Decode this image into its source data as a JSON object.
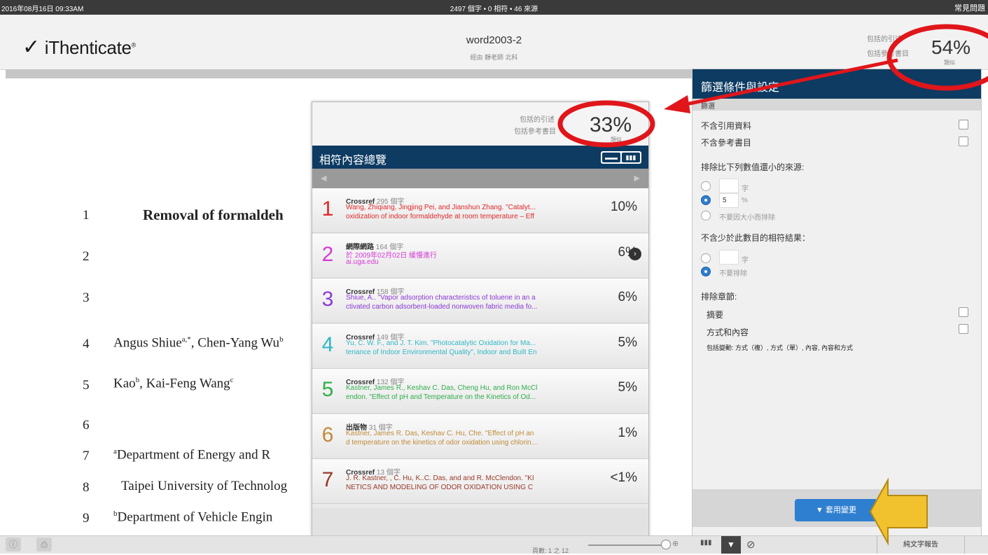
{
  "topbar": {
    "datetime": "2016年08月16日 09:33AM",
    "stats": "2497 個字 • 0 相符 • 46 來源",
    "help": "常見問題"
  },
  "header": {
    "logo_text": "iThenticate",
    "logo_mark": "®",
    "doc_title": "word2003-2",
    "doc_subtitle": "經由 靜老師 北科",
    "included_1": "包括的引述",
    "included_2": "包括參考書目",
    "similarity_pct": "54%",
    "similarity_label": "類似"
  },
  "document": {
    "line_numbers": [
      "1",
      "2",
      "3",
      "4",
      "5",
      "6",
      "7",
      "8",
      "9"
    ],
    "line1": "Removal of formaldeh",
    "line4_a": "Angus Shiue",
    "line4_sup": "a,*",
    "line4_b": ", Chen-Yang Wu",
    "line4_sup2": "b",
    "line5_a": "Kao",
    "line5_sup": "b",
    "line5_b": ", Kai-Feng Wang",
    "line5_sup2": "c",
    "line7_sup": "a",
    "line7": "Department of Energy and R",
    "line8": "Taipei University of Technolog",
    "line9_sup": "b",
    "line9": "Department of Vehicle Engin"
  },
  "match_panel": {
    "included_1": "包括的引述",
    "included_2": "包括參考書目",
    "similarity_pct": "33%",
    "similarity_label": "類似",
    "title": "相符內容總覽",
    "toggle_list": "▬▬",
    "toggle_chart": "▮▮▮",
    "rows": [
      {
        "num": "1",
        "color": "#e0282a",
        "source": "Crossref",
        "words": " 295 個字",
        "line1": "Wang, Zhiqiang, Jingjing Pei, and Jianshun Zhang. \"Catalyt...",
        "line2": "oxidization of indoor formaldehyde at room temperature – Eff",
        "pct": "10%"
      },
      {
        "num": "2",
        "color": "#d63ad6",
        "source": "網際網路",
        "words": " 164 個字",
        "line1": "於 2009年02月02日 緩慢進行",
        "line2": "ai.uga.edu",
        "pct": "6%"
      },
      {
        "num": "3",
        "color": "#8a3ad6",
        "source": "Crossref",
        "words": " 158 個字",
        "line1": "Shiue, A.. \"Vapor adsorption characteristics of toluene in an a",
        "line2": "ctivated carbon adsorbent-loaded nonwoven fabric media fo...",
        "pct": "6%"
      },
      {
        "num": "4",
        "color": "#2fb7c5",
        "source": "Crossref",
        "words": " 149 個字",
        "line1": "Yu, C. W. F., and J. T. Kim. \"Photocatalytic Oxidation for Ma...",
        "line2": "tenance of Indoor Environmental Quality\", Indoor and Built En",
        "pct": "5%"
      },
      {
        "num": "5",
        "color": "#2fae4a",
        "source": "Crossref",
        "words": " 132 個字",
        "line1": "Kastner, James R., Keshav C. Das, Cheng Hu, and Ron McCl",
        "line2": "endon. \"Effect of pH and Temperature on the Kinetics of Od...",
        "pct": "5%"
      },
      {
        "num": "6",
        "color": "#c08a3a",
        "source": "出版物",
        "words": " 31 個字",
        "line1": "Kastner, James R. Das, Keshav C. Hu, Che. \"Effect of pH an",
        "line2": "d temperature on the kinetics of odor oxidation using chlorin...",
        "pct": "1%"
      },
      {
        "num": "7",
        "color": "#9a3a2a",
        "source": "Crossref",
        "words": " 13 個字",
        "line1": "J. R. Kastner, , C. Hu, K..C. Das, and and R. McClendon. \"KI",
        "line2": "NETICS AND MODELING OF ODOR OXIDATION USING C",
        "pct": "<1%"
      }
    ]
  },
  "filter_panel": {
    "title": "篩選條件與設定",
    "section": "篩選",
    "exclude_quotes": "不含引用資料",
    "exclude_bib": "不含參考書目",
    "exclude_small_sources": "排除比下列數值還小的來源:",
    "unit_words": "字",
    "small_value": "5",
    "unit_pct": "%",
    "no_size_exclude": "不要因大小而排除",
    "exclude_matches_less": "不含少於此數目的相符結果：",
    "unit_words2": "字",
    "no_exclude": "不要排除",
    "exclude_sections": "排除章節:",
    "abstract": "摘要",
    "methods": "方式和內容",
    "methods_note": "包括變動: 方式（複）, 方式（單）, 內容, 內容和方式",
    "apply": "套用變更"
  },
  "bottombar": {
    "info": "ⓘ",
    "print": "⎙",
    "page_info": "頁數: 1 之 12",
    "chart": "▮▮▮",
    "filter": "▼",
    "exclude": "⊘",
    "text_report": "純文字報告"
  }
}
